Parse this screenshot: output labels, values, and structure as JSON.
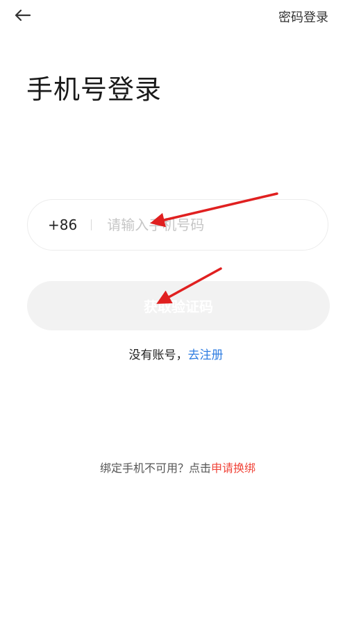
{
  "header": {
    "back_icon": "back-arrow-icon",
    "password_login_label": "密码登录"
  },
  "main": {
    "title": "手机号登录",
    "phone": {
      "country_code": "+86",
      "placeholder": "请输入手机号码",
      "value": ""
    },
    "get_code_label": "获取验证码",
    "register": {
      "prefix": "没有账号，",
      "link_label": "去注册"
    },
    "rebind": {
      "prefix": "绑定手机不可用？点击",
      "link_label": "申请换绑"
    }
  },
  "annotations": {
    "arrow_color": "#e02020",
    "count": 2
  },
  "colors": {
    "link_blue": "#2f7de1",
    "link_red": "#f0453a",
    "button_disabled_bg": "#f2f2f2",
    "placeholder": "#c6c6c6"
  }
}
